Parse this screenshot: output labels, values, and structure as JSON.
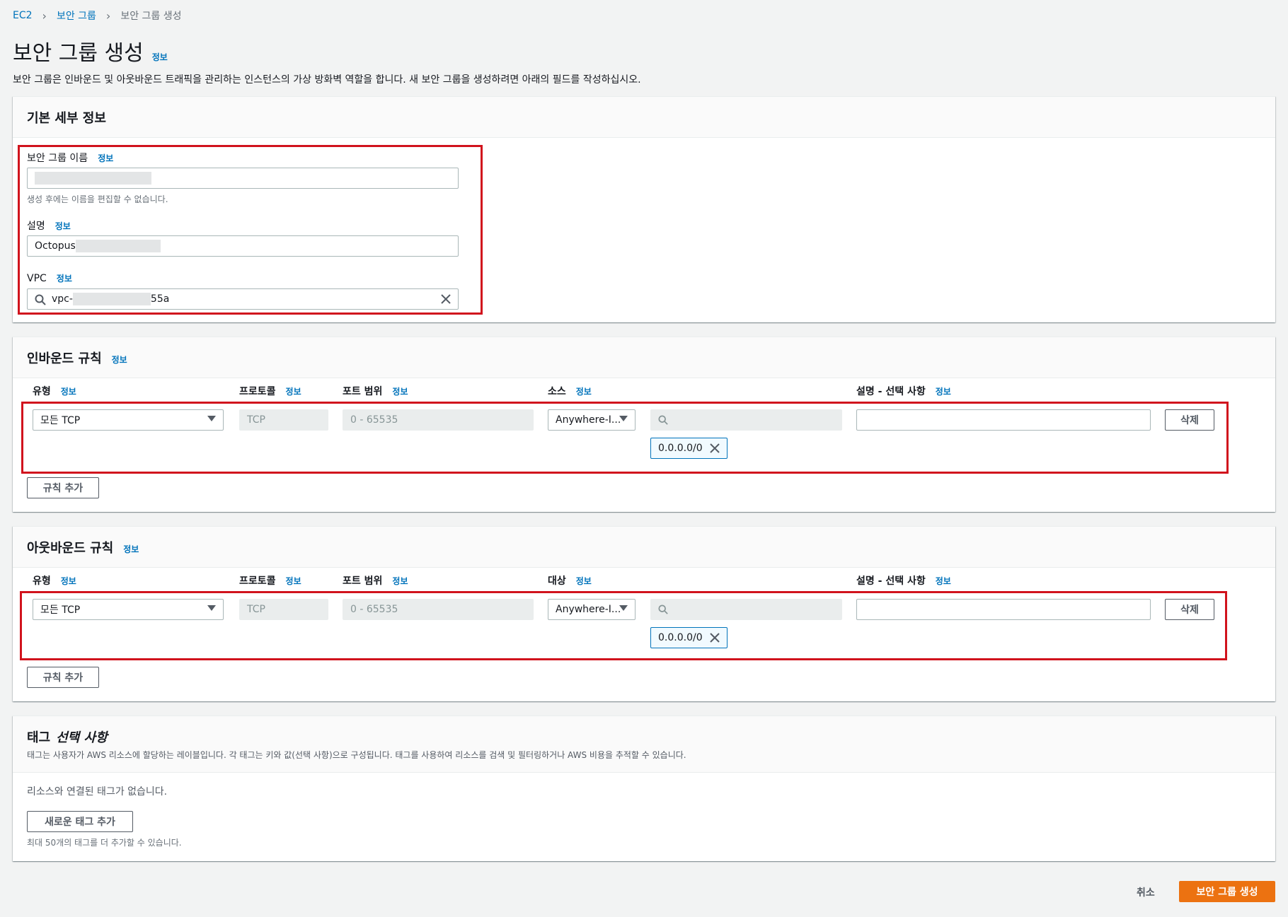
{
  "breadcrumb": {
    "root": "EC2",
    "parent": "보안 그룹",
    "current": "보안 그룹 생성"
  },
  "page": {
    "title": "보안 그룹 생성",
    "info": "정보",
    "description": "보안 그룹은 인바운드 및 아웃바운드 트래픽을 관리하는 인스턴스의 가상 방화벽 역할을 합니다. 새 보안 그룹을 생성하려면 아래의 필드를 작성하십시오."
  },
  "basic": {
    "title": "기본 세부 정보",
    "name_label": "보안 그룹 이름",
    "name_info": "정보",
    "name_hint": "생성 후에는 이름을 편집할 수 없습니다.",
    "desc_label": "설명",
    "desc_info": "정보",
    "desc_value": "Octopus",
    "vpc_label": "VPC",
    "vpc_info": "정보",
    "vpc_prefix": "vpc-",
    "vpc_suffix": "55a"
  },
  "inbound": {
    "title": "인바운드 규칙",
    "info": "정보",
    "col_type": "유형",
    "col_protocol": "프로토콜",
    "col_port": "포트 범위",
    "col_source": "소스",
    "col_desc": "설명 - 선택 사항",
    "col_info": "정보",
    "type_value": "모든 TCP",
    "protocol_value": "TCP",
    "port_value": "0 - 65535",
    "source_value": "Anywhere-I...",
    "cidr_token": "0.0.0.0/0",
    "delete_label": "삭제",
    "add_rule_label": "규칙 추가"
  },
  "outbound": {
    "title": "아웃바운드 규칙",
    "info": "정보",
    "col_type": "유형",
    "col_protocol": "프로토콜",
    "col_port": "포트 범위",
    "col_dest": "대상",
    "col_desc": "설명 - 선택 사항",
    "col_info": "정보",
    "type_value": "모든 TCP",
    "protocol_value": "TCP",
    "port_value": "0 - 65535",
    "dest_value": "Anywhere-I...",
    "cidr_token": "0.0.0.0/0",
    "delete_label": "삭제",
    "add_rule_label": "규칙 추가"
  },
  "tags": {
    "title_a": "태그",
    "title_b": "선택 사항",
    "description": "태그는 사용자가 AWS 리소스에 할당하는 레이블입니다. 각 태그는 키와 값(선택 사항)으로 구성됩니다. 태그를 사용하여 리소스를 검색 및 필터링하거나 AWS 비용을 추적할 수 있습니다.",
    "empty_text": "리소스와 연결된 태그가 없습니다.",
    "add_tag_label": "새로운 태그 추가",
    "limit_hint": "최대 50개의 태그를 더 추가할 수 있습니다."
  },
  "footer": {
    "cancel_label": "취소",
    "create_label": "보안 그룹 생성"
  },
  "colors": {
    "accent": "#ec7211",
    "link": "#0073bb",
    "highlight": "#d1131d"
  }
}
